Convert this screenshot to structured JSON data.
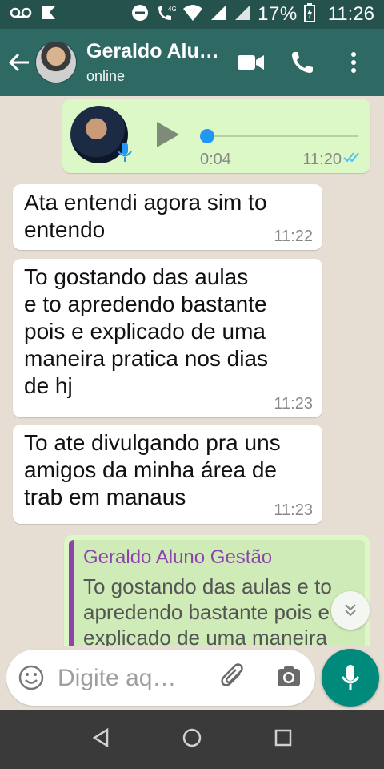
{
  "status_bar": {
    "network": "4G",
    "battery": "17%",
    "time": "11:26"
  },
  "header": {
    "contact_name": "Geraldo Alu…",
    "contact_status": "online"
  },
  "voice_message": {
    "duration": "0:04",
    "time": "11:20"
  },
  "messages": [
    {
      "text": "Ata entendi agora sim to\nentendo",
      "time": "11:22"
    },
    {
      "text": "To gostando das aulas\ne to apredendo bastante\npois e explicado de uma\nmaneira pratica nos dias\nde hj",
      "time": "11:23"
    },
    {
      "text": "To ate divulgando pra uns\namigos da minha área de\ntrab em manaus",
      "time": "11:23"
    }
  ],
  "quoted": {
    "name": "Geraldo Aluno Gestão",
    "text": "To gostando das aulas e to apredendo bastante pois e explicado de uma maneira"
  },
  "composer": {
    "placeholder": "Digite aq…"
  },
  "colors": {
    "header": "#2e6a63",
    "status_bar": "#25524c",
    "outgoing": "#dcf8c6",
    "accent": "#008a7c",
    "quote_bar": "#8e44ad",
    "read_ticks": "#4fc3f7"
  }
}
